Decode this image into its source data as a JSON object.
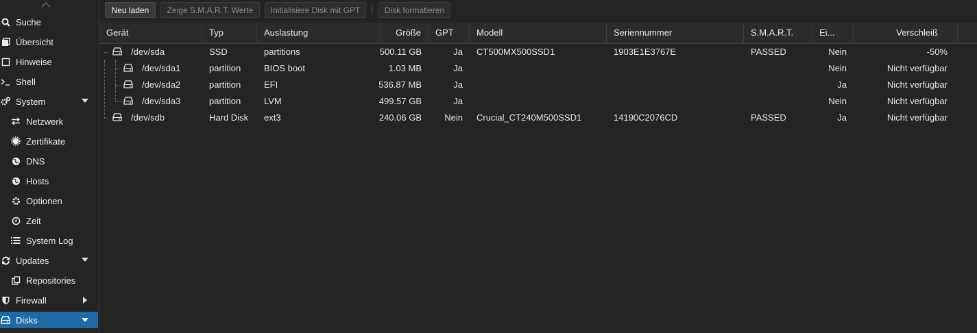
{
  "sidebar": {
    "items": [
      {
        "label": "Suche",
        "icon": "search-icon"
      },
      {
        "label": "Übersicht",
        "icon": "summary-icon"
      },
      {
        "label": "Hinweise",
        "icon": "notes-icon"
      },
      {
        "label": "Shell",
        "icon": "terminal-icon"
      },
      {
        "label": "System",
        "icon": "gears-icon"
      },
      {
        "label": "Netzwerk",
        "icon": "network-icon"
      },
      {
        "label": "Zertifikate",
        "icon": "certificate-icon"
      },
      {
        "label": "DNS",
        "icon": "globe-icon"
      },
      {
        "label": "Hosts",
        "icon": "globe-icon"
      },
      {
        "label": "Optionen",
        "icon": "gear-icon"
      },
      {
        "label": "Zeit",
        "icon": "clock-icon"
      },
      {
        "label": "System Log",
        "icon": "list-icon"
      },
      {
        "label": "Updates",
        "icon": "refresh-icon"
      },
      {
        "label": "Repositories",
        "icon": "copy-icon"
      },
      {
        "label": "Firewall",
        "icon": "shield-icon"
      },
      {
        "label": "Disks",
        "icon": "hdd-icon"
      }
    ]
  },
  "toolbar": {
    "reload": "Neu laden",
    "smart": "Zeige S.M.A.R.T. Werte",
    "init_gpt": "Initialisiere Disk mit GPT",
    "format": "Disk formatieren"
  },
  "grid": {
    "headers": [
      "Gerät",
      "Typ",
      "Auslastung",
      "Größe",
      "GPT",
      "Modell",
      "Seriennummer",
      "S.M.A.R.T.",
      "Ei...",
      "Verschleiß"
    ],
    "rows": [
      {
        "device": "/dev/sda",
        "type": "SSD",
        "usage": "partitions",
        "size": "500.11 GB",
        "gpt": "Ja",
        "model": "CT500MX500SSD1",
        "serial": "1903E1E3767E",
        "smart": "PASSED",
        "ei": "Nein",
        "wear": "-50%"
      },
      {
        "device": "/dev/sda1",
        "type": "partition",
        "usage": "BIOS boot",
        "size": "1.03 MB",
        "gpt": "Ja",
        "model": "",
        "serial": "",
        "smart": "",
        "ei": "Nein",
        "wear": "Nicht verfügbar"
      },
      {
        "device": "/dev/sda2",
        "type": "partition",
        "usage": "EFI",
        "size": "536.87 MB",
        "gpt": "Ja",
        "model": "",
        "serial": "",
        "smart": "",
        "ei": "Ja",
        "wear": "Nicht verfügbar"
      },
      {
        "device": "/dev/sda3",
        "type": "partition",
        "usage": "LVM",
        "size": "499.57 GB",
        "gpt": "Ja",
        "model": "",
        "serial": "",
        "smart": "",
        "ei": "Nein",
        "wear": "Nicht verfügbar"
      },
      {
        "device": "/dev/sdb",
        "type": "Hard Disk",
        "usage": "ext3",
        "size": "240.06 GB",
        "gpt": "Nein",
        "model": "Crucial_CT240M500SSD1",
        "serial": "14190C2076CD",
        "smart": "PASSED",
        "ei": "Ja",
        "wear": "Nicht verfügbar"
      }
    ]
  },
  "colors": {
    "accent": "#1f6aa5",
    "background": "#242424",
    "header": "#2b2b2b"
  }
}
